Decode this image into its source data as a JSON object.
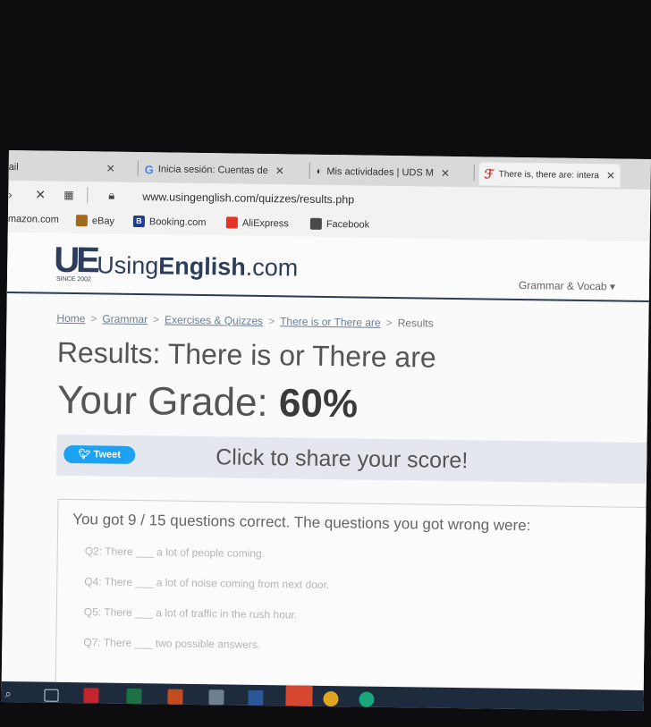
{
  "browser": {
    "tabs": [
      {
        "label": "ail"
      },
      {
        "label": "Inicia sesión: Cuentas de"
      },
      {
        "label": "Mis actividades | UDS M"
      },
      {
        "label": "There is, there are: intera"
      }
    ],
    "url": "www.usingenglish.com/quizzes/results.php",
    "bookmarks": [
      {
        "label": "mazon.com"
      },
      {
        "label": "eBay"
      },
      {
        "label": "Booking.com",
        "icon_letter": "B"
      },
      {
        "label": "AliExpress"
      },
      {
        "label": "Facebook"
      }
    ]
  },
  "site": {
    "logo_mark": "UE",
    "logo_since": "SINCE 2002",
    "logo_prefix": "Using",
    "logo_bold": "English",
    "logo_suffix": ".com",
    "nav_grammar": "Grammar & Vocab ▾"
  },
  "breadcrumb": {
    "home": "Home",
    "grammar": "Grammar",
    "exercises": "Exercises & Quizzes",
    "quiz": "There is or There are",
    "current": "Results"
  },
  "results": {
    "title": "Results: There is or There are",
    "grade_label": "Your Grade:",
    "grade_value": "60%",
    "tweet_label": "Tweet",
    "share_text": "Click to share your score!",
    "summary": "You got 9 / 15 questions correct. The questions you got wrong were:",
    "wrong_questions": [
      "Q2: There ___ a lot of people coming.",
      "Q4: There ___ a lot of noise coming from next door.",
      "Q5: There ___ a lot of traffic in the rush hour.",
      "Q7: There ___ two possible answers."
    ]
  },
  "colors": {
    "brand_navy": "#2d3d5c",
    "tweet_blue": "#1da1f2",
    "taskbar": "#1d2b3c"
  },
  "icons": [
    "google-icon",
    "moodle-icon",
    "lock-icon",
    "apps-grid-icon",
    "twitter-bird-icon"
  ]
}
